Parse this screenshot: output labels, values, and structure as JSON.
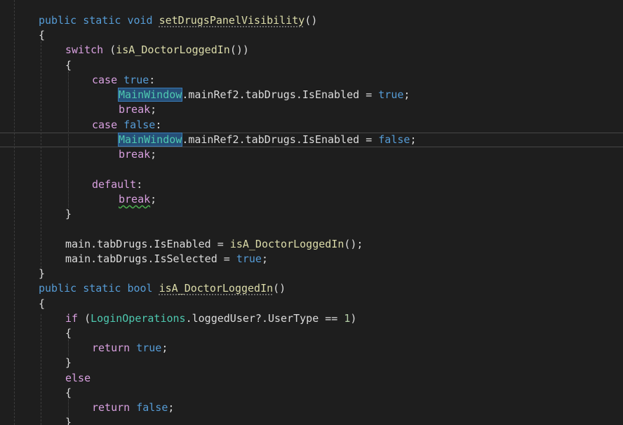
{
  "code": {
    "l1": {
      "kw1": "public",
      "kw2": "static",
      "kw3": "void",
      "name": "setDrugsPanelVisibility",
      "rest": "()"
    },
    "l2": "{",
    "l3": {
      "kw": "switch",
      "open": " (",
      "call": "isA_DoctorLoggedIn",
      "close": "())"
    },
    "l4": "{",
    "l5": {
      "kw": "case",
      "val": "true",
      "colon": ":"
    },
    "l6": {
      "type": "MainWindow",
      "mid": ".mainRef2.tabDrugs.IsEnabled = ",
      "val": "true",
      "end": ";"
    },
    "l7": {
      "kw": "break",
      "end": ";"
    },
    "l8": {
      "kw": "case",
      "val": "false",
      "colon": ":"
    },
    "l9": {
      "type": "MainWindow",
      "mid": ".mainRef2.tabDrugs.IsEnabled = ",
      "val": "false",
      "end": ";"
    },
    "l10": {
      "kw": "break",
      "end": ";"
    },
    "l11": {
      "kw": "default",
      "colon": ":"
    },
    "l12": {
      "kw": "break",
      "end": ";"
    },
    "l13": "}",
    "l14": {
      "start": "main.tabDrugs.IsEnabled = ",
      "call": "isA_DoctorLoggedIn",
      "end": "();"
    },
    "l15": {
      "start": "main.tabDrugs.IsSelected = ",
      "val": "true",
      "end": ";"
    },
    "l16": "}",
    "l17": {
      "kw1": "public",
      "kw2": "static",
      "kw3": "bool",
      "name": "isA_DoctorLoggedIn",
      "rest": "()"
    },
    "l18": "{",
    "l19": {
      "kw": "if",
      "open": " (",
      "type": "LoginOperations",
      "mid": ".loggedUser?.UserType == ",
      "num": "1",
      "close": ")"
    },
    "l20": "{",
    "l21": {
      "kw": "return",
      "val": "true",
      "end": ";"
    },
    "l22": "}",
    "l23": {
      "kw": "else"
    },
    "l24": "{",
    "l25": {
      "kw": "return",
      "val": "false",
      "end": ";"
    },
    "l26": "}"
  },
  "colors": {
    "background": "#1e1e1e",
    "keyword": "#569cd6",
    "control": "#d8a0df",
    "function": "#dcdcaa",
    "type": "#4ec9b0",
    "number": "#b5cea8"
  }
}
